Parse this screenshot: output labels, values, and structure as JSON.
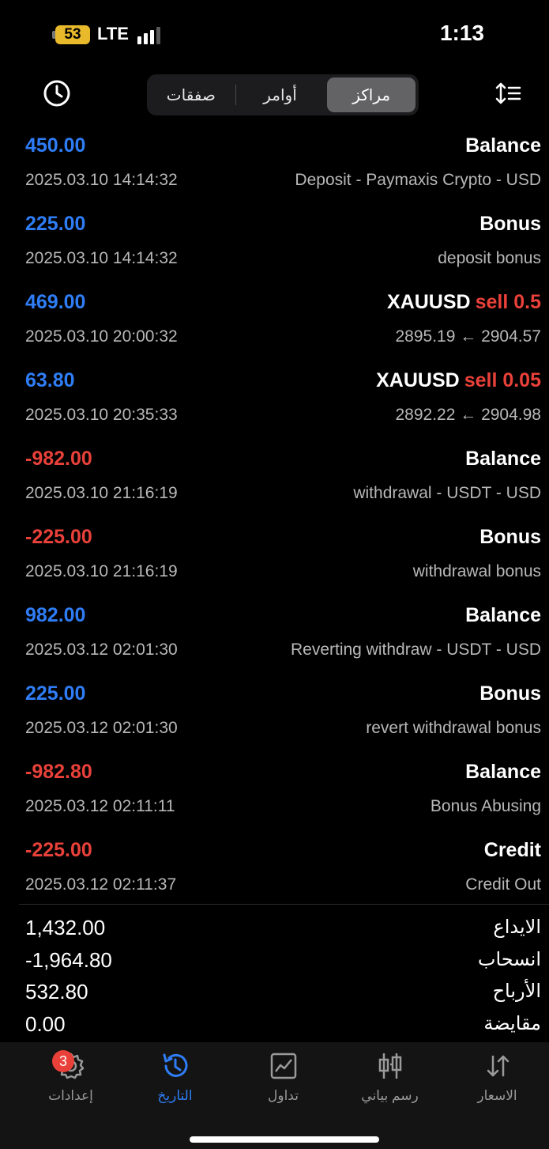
{
  "status_bar": {
    "battery": "53",
    "network": "LTE",
    "time": "1:13"
  },
  "toolbar": {
    "tabs": [
      {
        "label": "صفقات",
        "active": false
      },
      {
        "label": "أوامر",
        "active": false
      },
      {
        "label": "مراكز",
        "active": true
      }
    ]
  },
  "transactions": [
    {
      "amount": "450.00",
      "time": "2025.03.10 14:14:32",
      "title": "Balance",
      "side": "",
      "desc": "Deposit - Paymaxis Crypto - USD",
      "type": "pos"
    },
    {
      "amount": "225.00",
      "time": "2025.03.10 14:14:32",
      "title": "Bonus",
      "side": "",
      "desc": "deposit bonus",
      "type": "pos"
    },
    {
      "amount": "469.00",
      "time": "2025.03.10 20:00:32",
      "title": "XAUUSD",
      "side": "sell 0.5",
      "desc": "2895.19 ← 2904.57",
      "type": "pos"
    },
    {
      "amount": "63.80",
      "time": "2025.03.10 20:35:33",
      "title": "XAUUSD",
      "side": "sell 0.05",
      "desc": "2892.22 ← 2904.98",
      "type": "pos"
    },
    {
      "amount": "-982.00",
      "time": "2025.03.10 21:16:19",
      "title": "Balance",
      "side": "",
      "desc": "withdrawal - USDT - USD",
      "type": "neg"
    },
    {
      "amount": "-225.00",
      "time": "2025.03.10 21:16:19",
      "title": "Bonus",
      "side": "",
      "desc": "withdrawal bonus",
      "type": "neg"
    },
    {
      "amount": "982.00",
      "time": "2025.03.12 02:01:30",
      "title": "Balance",
      "side": "",
      "desc": "Reverting withdraw - USDT - USD",
      "type": "pos"
    },
    {
      "amount": "225.00",
      "time": "2025.03.12 02:01:30",
      "title": "Bonus",
      "side": "",
      "desc": "revert withdrawal bonus",
      "type": "pos"
    },
    {
      "amount": "-982.80",
      "time": "2025.03.12 02:11:11",
      "title": "Balance",
      "side": "",
      "desc": "Bonus Abusing",
      "type": "neg"
    },
    {
      "amount": "-225.00",
      "time": "2025.03.12 02:11:37",
      "title": "Credit",
      "side": "",
      "desc": "Credit Out",
      "type": "neg"
    }
  ],
  "summary": [
    {
      "label": "الايداع",
      "value": "1,432.00"
    },
    {
      "label": "انسحاب",
      "value": "-1,964.80"
    },
    {
      "label": "الأرباح",
      "value": "532.80"
    },
    {
      "label": "مقايضة",
      "value": "0.00"
    }
  ],
  "tabbar": {
    "settings": {
      "label": "إعدادات",
      "badge": "3"
    },
    "history": {
      "label": "التاريخ"
    },
    "trade": {
      "label": "تداول"
    },
    "chart": {
      "label": "رسم بياني"
    },
    "quotes": {
      "label": "الاسعار"
    }
  },
  "colors": {
    "positive": "#2f7df6",
    "negative": "#e9413a",
    "active_tab": "#2f7df6"
  }
}
